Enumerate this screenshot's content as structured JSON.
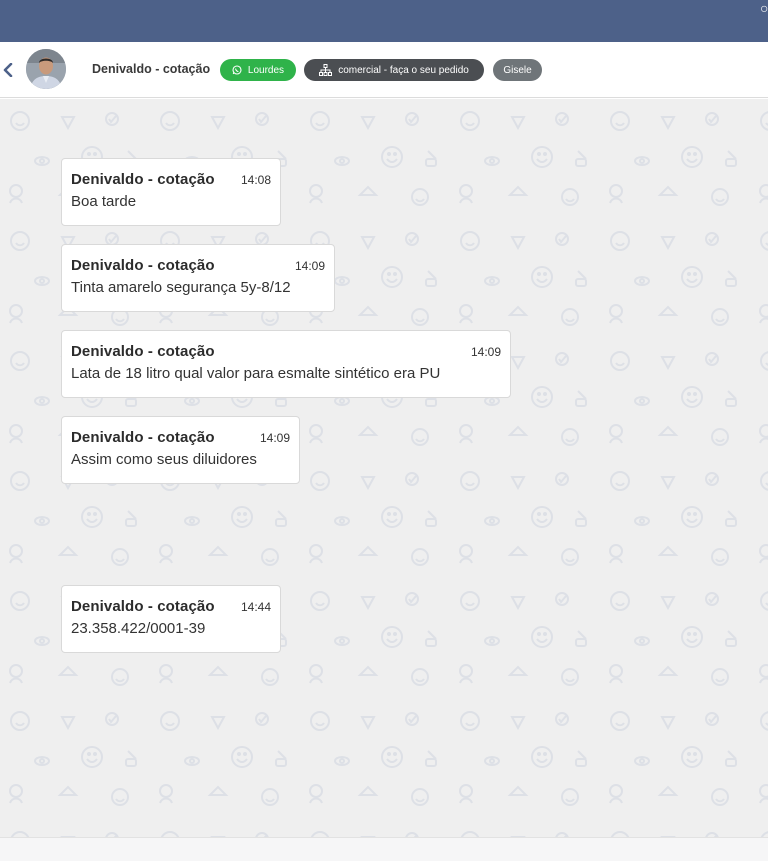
{
  "header": {
    "contact_name": "Denivaldo - cotação",
    "tags": {
      "lourdes": "Lourdes",
      "comercial": "comercial - faça o seu pedido",
      "gisele": "Gisele"
    }
  },
  "messages": [
    {
      "author": "Denivaldo - cotação",
      "time": "14:08",
      "text": "Boa tarde"
    },
    {
      "author": "Denivaldo - cotação",
      "time": "14:09",
      "text": "Tinta amarelo segurança 5y-8/12"
    },
    {
      "author": "Denivaldo - cotação",
      "time": "14:09",
      "text": "Lata de 18 litro qual valor para esmalte sintético era PU"
    },
    {
      "author": "Denivaldo - cotação",
      "time": "14:09",
      "text": "Assim como seus diluidores"
    },
    {
      "author": "Denivaldo - cotação",
      "time": "14:44",
      "text": "23.358.422/0001-39"
    }
  ],
  "colors": {
    "topbar": "#4d6189",
    "tag_whatsapp": "#2fb34a",
    "tag_queue": "#4b4e52",
    "tag_user": "#6f7579",
    "chat_background": "#efefef"
  },
  "icons": {
    "back": "chevron-left-icon",
    "whatsapp": "whatsapp-icon",
    "queue": "sitemap-icon",
    "topbar": "chat-bubble-icon"
  }
}
